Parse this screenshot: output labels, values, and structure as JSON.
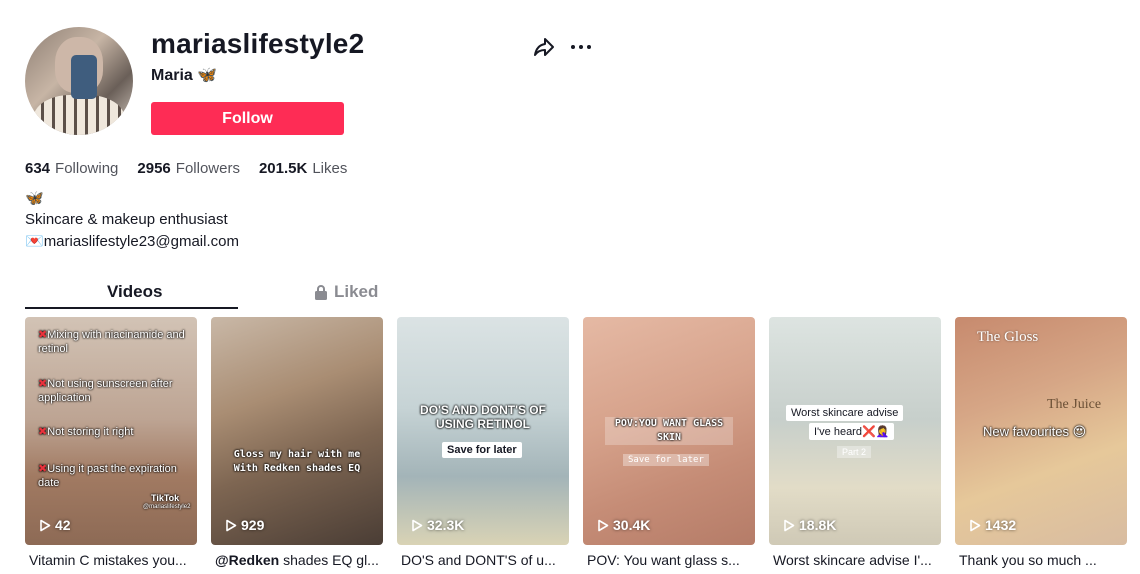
{
  "profile": {
    "username": "mariaslifestyle2",
    "nickname": "Maria",
    "nickname_emoji": "🦋",
    "follow_label": "Follow"
  },
  "stats": {
    "following_count": "634",
    "following_label": "Following",
    "followers_count": "2956",
    "followers_label": "Followers",
    "likes_count": "201.5K",
    "likes_label": "Likes"
  },
  "bio": {
    "emoji": "🦋",
    "line1": "Skincare & makeup enthusiast",
    "email_emoji": "💌",
    "email": "mariaslifestyle23@gmail.com"
  },
  "tabs": {
    "videos": "Videos",
    "liked": "Liked"
  },
  "videos": [
    {
      "views": "42",
      "caption": "Vitamin C mistakes you...",
      "overlay": [
        "Mixing with niacinamide and retinol",
        "Not using sunscreen after application",
        "Not storing it right",
        "Using it past the expiration date"
      ],
      "watermark": "TikTok",
      "watermark_handle": "@mariaslifestyle2"
    },
    {
      "views": "929",
      "caption_mention": "@Redken",
      "caption": "shades EQ gl...",
      "overlay": "Gloss my hair with me With Redken shades EQ"
    },
    {
      "views": "32.3K",
      "caption": "DO'S and DONT'S of u...",
      "overlay": "DO'S AND DONT'S OF USING RETINOL",
      "pill": "Save for later"
    },
    {
      "views": "30.4K",
      "caption": "POV: You want glass s...",
      "overlay": "POV:YOU WANT GLASS SKIN",
      "pill": "Save for later"
    },
    {
      "views": "18.8K",
      "caption": "Worst skincare advise I'...",
      "overlay_line1": "Worst skincare advise",
      "overlay_line2": "I've heard❌🤦‍♀️",
      "pill": "Part 2"
    },
    {
      "views": "1432",
      "caption": "Thank you so much ...",
      "overlay": "New favourites 😍",
      "bottle1": "The Gloss",
      "bottle2": "The Juice"
    }
  ],
  "colors": {
    "accent": "#fe2c55",
    "text": "#161823"
  },
  "icons": {
    "share": "share-icon",
    "more": "more-icon",
    "lock": "lock-icon",
    "play": "play-icon",
    "x_mark": "red-x-icon"
  }
}
